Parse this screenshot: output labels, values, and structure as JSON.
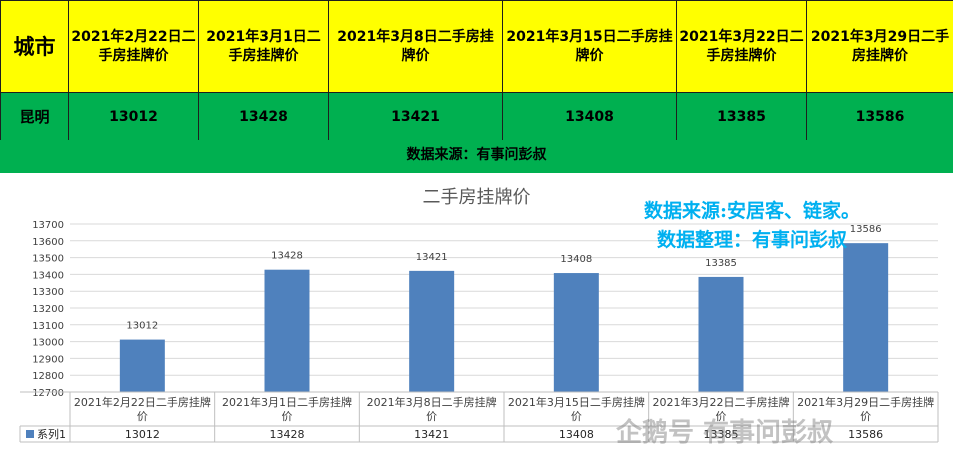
{
  "table": {
    "city_header": "城市",
    "headers": [
      "2021年2月22日二手房挂牌价",
      "2021年3月1日二手房挂牌价",
      "2021年3月8日二手房挂牌价",
      "2021年3月15日二手房挂牌价",
      "2021年3月22日二手房挂牌价",
      "2021年3月29日二手房挂牌价"
    ],
    "city": "昆明",
    "values": [
      "13012",
      "13428",
      "13421",
      "13408",
      "13385",
      "13586"
    ]
  },
  "source_bar": "数据来源：有事问彭叔",
  "annotations": {
    "line1": "数据来源:安居客、链家。",
    "line2": "数据整理：有事问彭叔"
  },
  "watermark": "企鹅号 有事问彭叔",
  "colors": {
    "header_bg": "#ffff00",
    "row_bg": "#00b050",
    "bar": "#4f81bd",
    "annotation": "#00b0f0"
  },
  "chart_data": {
    "type": "bar",
    "title": "二手房挂牌价",
    "categories": [
      "2021年2月22日二手房挂牌价",
      "2021年3月1日二手房挂牌价",
      "2021年3月8日二手房挂牌价",
      "2021年3月15日二手房挂牌价",
      "2021年3月22日二手房挂牌价",
      "2021年3月29日二手房挂牌价"
    ],
    "series": [
      {
        "name": "系列1",
        "values": [
          13012,
          13428,
          13421,
          13408,
          13385,
          13586
        ]
      }
    ],
    "data_labels": [
      "13012",
      "13428",
      "13421",
      "13408",
      "13385",
      "13586"
    ],
    "ylim": [
      12700,
      13700
    ],
    "yticks": [
      12700,
      12800,
      12900,
      13000,
      13100,
      13200,
      13300,
      13400,
      13500,
      13600,
      13700
    ],
    "grid": true,
    "legend": "data-table-bottom"
  }
}
